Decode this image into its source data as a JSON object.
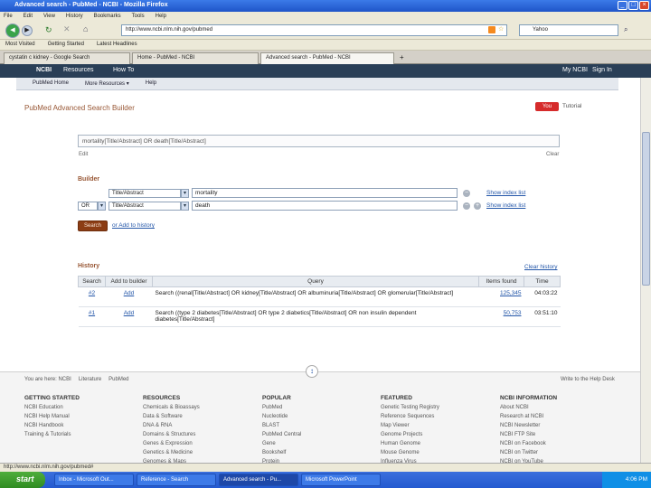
{
  "window": {
    "title": "Advanced search - PubMed - NCBI - Mozilla Firefox"
  },
  "menu": [
    "File",
    "Edit",
    "View",
    "History",
    "Bookmarks",
    "Tools",
    "Help"
  ],
  "nav": {
    "url": "http://www.ncbi.nlm.nih.gov/pubmed",
    "search_placeholder": "Yahoo"
  },
  "bookmarks": [
    "Most Visited",
    "Getting Started",
    "Latest Headlines"
  ],
  "tabs": [
    "cystatin c kidney - Google Search",
    "Home - PubMed - NCBI",
    "Advanced search - PubMed - NCBI"
  ],
  "ncbi": {
    "logo": "NCBI",
    "resources": "Resources",
    "howto": "How To",
    "user": "My NCBI",
    "signin": "Sign In"
  },
  "subnav": [
    "PubMed Home",
    "More Resources",
    "Help"
  ],
  "page": {
    "title": "PubMed Advanced Search Builder",
    "tutorial": "Tutorial",
    "query": "mortality[Title/Abstract] OR death[Title/Abstract]",
    "edit": "Edit",
    "clear": "Clear"
  },
  "builder": {
    "heading": "Builder",
    "rows": [
      {
        "op": "",
        "field": "Title/Abstract",
        "term": "mortality",
        "index": "Show index list"
      },
      {
        "op": "OR",
        "field": "Title/Abstract",
        "term": "death",
        "index": "Show index list"
      }
    ],
    "search_btn": "Search",
    "add_history": "or Add to history"
  },
  "history": {
    "heading": "History",
    "clear": "Clear history",
    "columns": [
      "Search",
      "Add to builder",
      "Query",
      "Items found",
      "Time"
    ],
    "rows": [
      {
        "search": "#2",
        "add": "Add",
        "query": "Search ((renal[Title/Abstract] OR kidney[Title/Abstract] OR albuminuria[Title/Abstract] OR glomerular[Title/Abstract]",
        "items": "125,345",
        "time": "04:03:22"
      },
      {
        "search": "#1",
        "add": "Add",
        "query": "Search ((type 2 diabetes[Title/Abstract] OR type 2 diabetics[Title/Abstract] OR non insulin dependent diabetes[Title/Abstract]",
        "items": "50,753",
        "time": "03:51:10"
      }
    ]
  },
  "footer": {
    "left_links": [
      "You are here: NCBI",
      "Literature",
      "PubMed"
    ],
    "right_link": "Write to the Help Desk",
    "columns": [
      {
        "title": "GETTING STARTED",
        "items": [
          "NCBI Education",
          "NCBI Help Manual",
          "NCBI Handbook",
          "Training & Tutorials"
        ]
      },
      {
        "title": "RESOURCES",
        "items": [
          "Chemicals & Bioassays",
          "Data & Software",
          "DNA & RNA",
          "Domains & Structures",
          "Genes & Expression",
          "Genetics & Medicine",
          "Genomes & Maps"
        ]
      },
      {
        "title": "POPULAR",
        "items": [
          "PubMed",
          "Nucleotide",
          "BLAST",
          "PubMed Central",
          "Gene",
          "Bookshelf",
          "Protein"
        ]
      },
      {
        "title": "FEATURED",
        "items": [
          "Genetic Testing Registry",
          "Reference Sequences",
          "Map Viewer",
          "Genome Projects",
          "Human Genome",
          "Mouse Genome",
          "Influenza Virus"
        ]
      },
      {
        "title": "NCBI INFORMATION",
        "items": [
          "About NCBI",
          "Research at NCBI",
          "NCBI Newsletter",
          "NCBI FTP Site",
          "NCBI on Facebook",
          "NCBI on Twitter",
          "NCBI on YouTube"
        ]
      }
    ]
  },
  "status": "http://www.ncbi.nlm.nih.gov/pubmed#",
  "taskbar": {
    "start": "start",
    "tasks": [
      "Inbox - Microsoft Out...",
      "Reference - Search",
      "Advanced search - Pu...",
      "Microsoft PowerPoint"
    ],
    "clock": "4:06 PM"
  }
}
